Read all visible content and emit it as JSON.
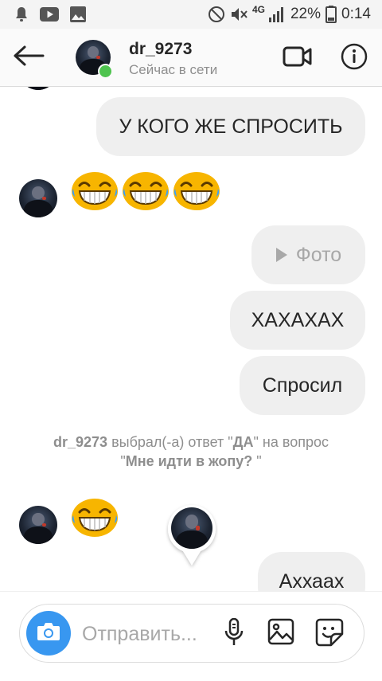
{
  "status_bar": {
    "network": "4G",
    "battery": "22%",
    "time": "0:14"
  },
  "header": {
    "name": "dr_9273",
    "status": "Сейчас в сети"
  },
  "messages": {
    "m1": "У КОГО ЖЕ СПРОСИТЬ",
    "photo_label": "Фото",
    "m3": "ХАХАХАХ",
    "m4": "Спросил",
    "m5": "Аххаах"
  },
  "system_note": {
    "user": "dr_9273",
    "action": " выбрал(-а) ответ \"",
    "answer": "ДА",
    "mid": "\" на вопрос",
    "q_open": "\"",
    "question": "Мне идти в жопу?",
    "q_close": " \""
  },
  "composer": {
    "placeholder": "Отправить..."
  },
  "icons": {
    "back": "arrow-left-icon",
    "video": "video-camera-icon",
    "info": "info-icon",
    "camera": "camera-icon",
    "mic": "microphone-icon",
    "gallery": "image-icon",
    "sticker": "sticker-icon",
    "emoji": "laughing-emoji"
  },
  "colors": {
    "accent": "#3897f0",
    "online": "#4ec34e",
    "bubble": "#efefef",
    "muted": "#8e8e8e"
  }
}
